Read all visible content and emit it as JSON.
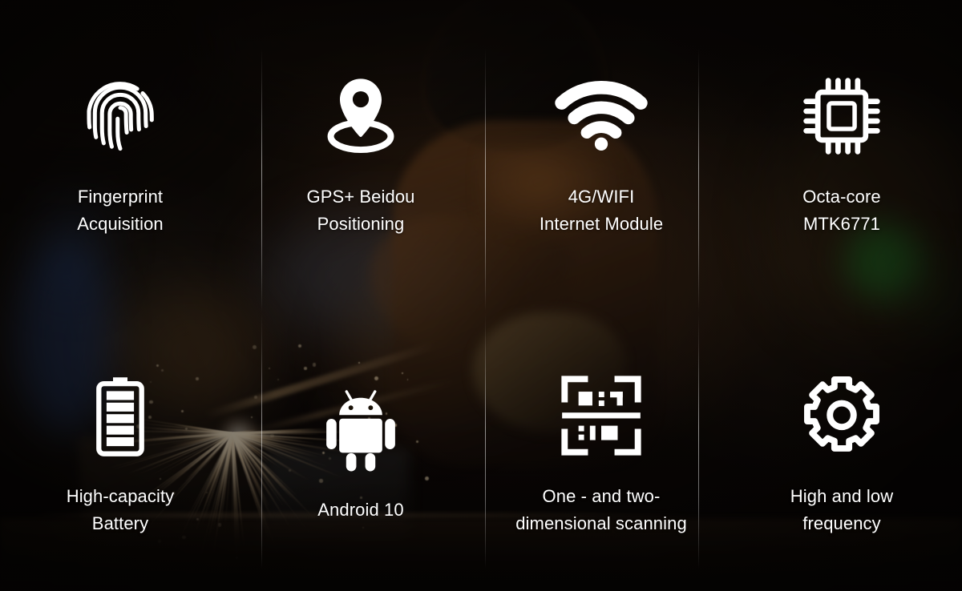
{
  "banner": {
    "background_description": "industrial welder with sparks, dark warm-toned photo",
    "accent_colors": {
      "text": "#ffffff",
      "icon": "#ffffff",
      "divider": "#ffffff",
      "background_dark": "#0d0907",
      "background_warm": "#5c381c",
      "bokeh_green": "#289630",
      "bokeh_blue": "#28467f",
      "spark": "#fff2d6"
    }
  },
  "features": [
    {
      "icon": "fingerprint-icon",
      "label": "Fingerprint\nAcquisition",
      "line1": "Fingerprint",
      "line2": "Acquisition"
    },
    {
      "icon": "location-pin-icon",
      "label": "GPS+ Beidou\nPositioning",
      "line1": "GPS+ Beidou",
      "line2": "Positioning"
    },
    {
      "icon": "wifi-icon",
      "label": "4G/WIFI\nInternet Module",
      "line1": "4G/WIFI",
      "line2": "Internet Module"
    },
    {
      "icon": "cpu-chip-icon",
      "label": "Octa-core\nMTK6771",
      "line1": "Octa-core",
      "line2": "MTK6771"
    },
    {
      "icon": "battery-icon",
      "label": "High-capacity\nBattery",
      "line1": "High-capacity",
      "line2": "Battery"
    },
    {
      "icon": "android-robot-icon",
      "label": "Android 10",
      "line1": "Android 10",
      "line2": ""
    },
    {
      "icon": "qr-scanner-icon",
      "label": "One - and two-\ndimensional scanning",
      "line1": "One - and two-",
      "line2": "dimensional scanning"
    },
    {
      "icon": "gear-icon",
      "label": "High and low\nfrequency",
      "line1": "High and low",
      "line2": "frequency"
    }
  ]
}
